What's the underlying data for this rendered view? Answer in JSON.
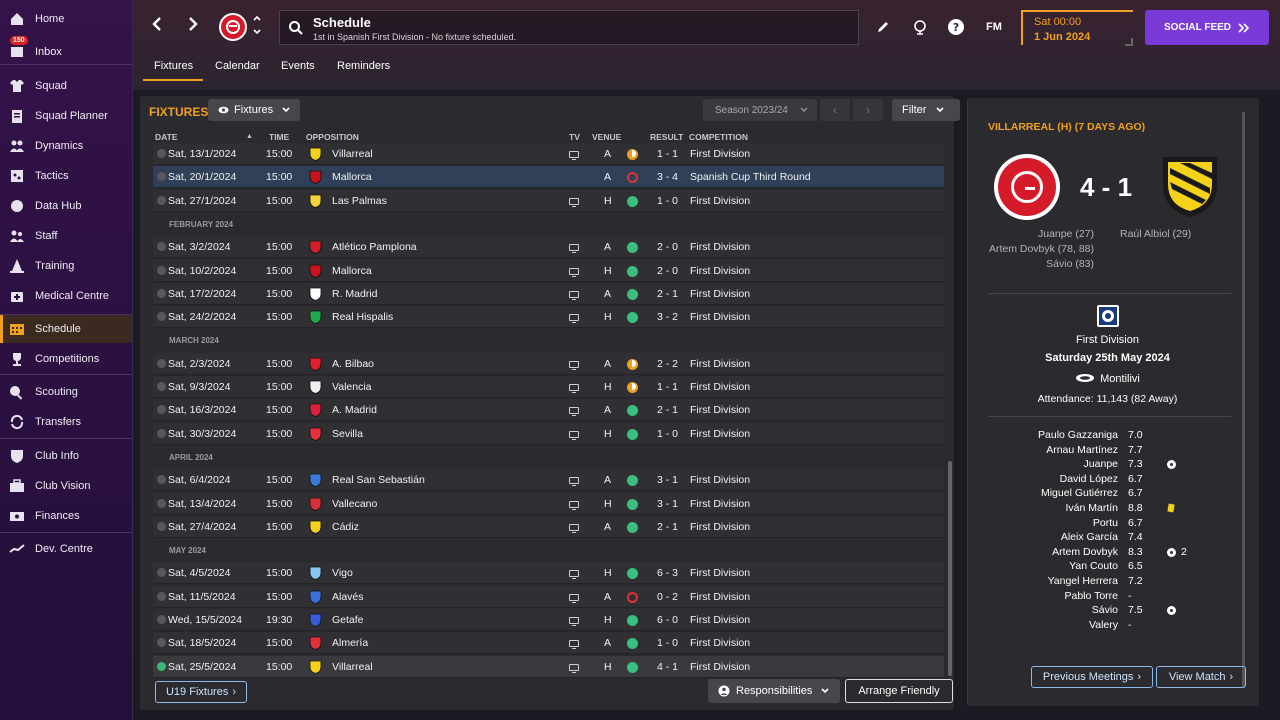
{
  "sidebar": {
    "items": [
      {
        "label": "Home",
        "icon": "home-icon"
      },
      {
        "label": "Inbox",
        "icon": "inbox-icon",
        "badge": "150"
      },
      {
        "label": "Squad",
        "icon": "shirt-icon"
      },
      {
        "label": "Squad Planner",
        "icon": "clipboard-icon"
      },
      {
        "label": "Dynamics",
        "icon": "people-icon"
      },
      {
        "label": "Tactics",
        "icon": "tactics-board-icon"
      },
      {
        "label": "Data Hub",
        "icon": "data-hub-icon"
      },
      {
        "label": "Staff",
        "icon": "staff-icon"
      },
      {
        "label": "Training",
        "icon": "cone-icon"
      },
      {
        "label": "Medical Centre",
        "icon": "medical-icon"
      },
      {
        "label": "Schedule",
        "icon": "calendar-icon"
      },
      {
        "label": "Competitions",
        "icon": "trophy-icon"
      },
      {
        "label": "Scouting",
        "icon": "binoculars-icon"
      },
      {
        "label": "Transfers",
        "icon": "transfer-icon"
      },
      {
        "label": "Club Info",
        "icon": "shield-icon"
      },
      {
        "label": "Club Vision",
        "icon": "briefcase-icon"
      },
      {
        "label": "Finances",
        "icon": "money-icon"
      },
      {
        "label": "Dev. Centre",
        "icon": "dev-centre-icon"
      }
    ]
  },
  "header": {
    "title": "Schedule",
    "subtitle": "1st in Spanish First Division - No fixture scheduled.",
    "fm_label": "FM",
    "date_time": "Sat 00:00",
    "date_day": "1 Jun 2024",
    "social_label": "SOCIAL FEED",
    "tabs": [
      "Fixtures",
      "Calendar",
      "Events",
      "Reminders"
    ]
  },
  "fixtures": {
    "label": "FIXTURES",
    "view_dropdown": "Fixtures",
    "season": "Season 2023/24",
    "filter_label": "Filter",
    "columns": {
      "date": "DATE",
      "time": "TIME",
      "opposition": "OPPOSITION",
      "tv": "TV",
      "venue": "VENUE",
      "result": "RESULT",
      "competition": "COMPETITION"
    },
    "rows": [
      {
        "type": "match",
        "date": "Sat, 13/1/2024",
        "time": "15:00",
        "team": "Villarreal",
        "crest": "#f3d219",
        "tv": true,
        "venue": "A",
        "outcome": "D",
        "score": "1 - 1",
        "competition": "First Division"
      },
      {
        "type": "match",
        "date": "Sat, 20/1/2024",
        "time": "15:00",
        "team": "Mallorca",
        "crest": "#c8121e",
        "tv": false,
        "venue": "A",
        "outcome": "L",
        "score": "3 - 4",
        "competition": "Spanish Cup Third Round",
        "selected": true
      },
      {
        "type": "match",
        "date": "Sat, 27/1/2024",
        "time": "15:00",
        "team": "Las Palmas",
        "crest": "#f6d33a",
        "tv": true,
        "venue": "H",
        "outcome": "W",
        "score": "1 - 0",
        "competition": "First Division"
      },
      {
        "type": "month",
        "label": "FEBRUARY 2024"
      },
      {
        "type": "match",
        "date": "Sat, 3/2/2024",
        "time": "15:00",
        "team": "Atlético Pamplona",
        "crest": "#d5202c",
        "tv": true,
        "venue": "A",
        "outcome": "W",
        "score": "2 - 0",
        "competition": "First Division"
      },
      {
        "type": "match",
        "date": "Sat, 10/2/2024",
        "time": "15:00",
        "team": "Mallorca",
        "crest": "#c8121e",
        "tv": true,
        "venue": "H",
        "outcome": "W",
        "score": "2 - 0",
        "competition": "First Division"
      },
      {
        "type": "match",
        "date": "Sat, 17/2/2024",
        "time": "15:00",
        "team": "R. Madrid",
        "crest": "#ffffff",
        "tv": true,
        "venue": "A",
        "outcome": "W",
        "score": "2 - 1",
        "competition": "First Division"
      },
      {
        "type": "match",
        "date": "Sat, 24/2/2024",
        "time": "15:00",
        "team": "Real Hispalis",
        "crest": "#1fa84c",
        "tv": true,
        "venue": "H",
        "outcome": "W",
        "score": "3 - 2",
        "competition": "First Division"
      },
      {
        "type": "month",
        "label": "MARCH 2024"
      },
      {
        "type": "match",
        "date": "Sat, 2/3/2024",
        "time": "15:00",
        "team": "A. Bilbao",
        "crest": "#e02030",
        "tv": true,
        "venue": "A",
        "outcome": "D",
        "score": "2 - 2",
        "competition": "First Division"
      },
      {
        "type": "match",
        "date": "Sat, 9/3/2024",
        "time": "15:00",
        "team": "Valencia",
        "crest": "#f0f0f0",
        "tv": true,
        "venue": "H",
        "outcome": "D",
        "score": "1 - 1",
        "competition": "First Division"
      },
      {
        "type": "match",
        "date": "Sat, 16/3/2024",
        "time": "15:00",
        "team": "A. Madrid",
        "crest": "#d8243a",
        "tv": true,
        "venue": "A",
        "outcome": "W",
        "score": "2 - 1",
        "competition": "First Division"
      },
      {
        "type": "match",
        "date": "Sat, 30/3/2024",
        "time": "15:00",
        "team": "Sevilla",
        "crest": "#e8303a",
        "tv": true,
        "venue": "H",
        "outcome": "W",
        "score": "1 - 0",
        "competition": "First Division"
      },
      {
        "type": "month",
        "label": "APRIL 2024"
      },
      {
        "type": "match",
        "date": "Sat, 6/4/2024",
        "time": "15:00",
        "team": "Real San Sebastián",
        "crest": "#3a7ad8",
        "tv": true,
        "venue": "A",
        "outcome": "W",
        "score": "3 - 1",
        "competition": "First Division"
      },
      {
        "type": "match",
        "date": "Sat, 13/4/2024",
        "time": "15:00",
        "team": "Vallecano",
        "crest": "#d8303a",
        "tv": true,
        "venue": "H",
        "outcome": "W",
        "score": "3 - 1",
        "competition": "First Division"
      },
      {
        "type": "match",
        "date": "Sat, 27/4/2024",
        "time": "15:00",
        "team": "Cádiz",
        "crest": "#f3d219",
        "tv": true,
        "venue": "A",
        "outcome": "W",
        "score": "2 - 1",
        "competition": "First Division"
      },
      {
        "type": "month",
        "label": "MAY 2024"
      },
      {
        "type": "match",
        "date": "Sat, 4/5/2024",
        "time": "15:00",
        "team": "Vigo",
        "crest": "#8ac4f0",
        "tv": true,
        "venue": "H",
        "outcome": "W",
        "score": "6 - 3",
        "competition": "First Division"
      },
      {
        "type": "match",
        "date": "Sat, 11/5/2024",
        "time": "15:00",
        "team": "Alavés",
        "crest": "#3a6ed8",
        "tv": true,
        "venue": "A",
        "outcome": "L",
        "score": "0 - 2",
        "competition": "First Division"
      },
      {
        "type": "match",
        "date": "Wed, 15/5/2024",
        "time": "19:30",
        "team": "Getafe",
        "crest": "#3a5ad8",
        "tv": true,
        "venue": "H",
        "outcome": "W",
        "score": "6 - 0",
        "competition": "First Division"
      },
      {
        "type": "match",
        "date": "Sat, 18/5/2024",
        "time": "15:00",
        "team": "Almería",
        "crest": "#e0303a",
        "tv": true,
        "venue": "A",
        "outcome": "W",
        "score": "1 - 0",
        "competition": "First Division"
      },
      {
        "type": "match",
        "date": "Sat, 25/5/2024",
        "time": "15:00",
        "team": "Villarreal",
        "crest": "#f3d219",
        "tv": true,
        "venue": "H",
        "outcome": "W",
        "score": "4 - 1",
        "competition": "First Division",
        "last": true
      }
    ],
    "u19_label": "U19 Fixtures",
    "responsibilities_label": "Responsibilities",
    "arrange_friendly_label": "Arrange Friendly"
  },
  "match_panel": {
    "heading": "VILLARREAL (H) (7 DAYS AGO)",
    "score": "4 - 1",
    "home_scorers": [
      "Juanpe (27)",
      "Artem Dovbyk (78, 88)",
      "Sávio (83)"
    ],
    "away_scorers": [
      "Raúl Albiol (29)"
    ],
    "competition": "First Division",
    "date": "Saturday 25th May 2024",
    "stadium": "Montilivi",
    "attendance": "Attendance: 11,143 (82 Away)",
    "players": [
      {
        "name": "Paulo Gazzaniga",
        "rating": "7.0"
      },
      {
        "name": "Arnau Martínez",
        "rating": "7.7"
      },
      {
        "name": "Juanpe",
        "rating": "7.3",
        "goal": true
      },
      {
        "name": "David López",
        "rating": "6.7"
      },
      {
        "name": "Miguel Gutiérrez",
        "rating": "6.7"
      },
      {
        "name": "Iván Martín",
        "rating": "8.8",
        "card": true
      },
      {
        "name": "Portu",
        "rating": "6.7"
      },
      {
        "name": "Aleix García",
        "rating": "7.4"
      },
      {
        "name": "Artem Dovbyk",
        "rating": "8.3",
        "goal": true,
        "goals": "2"
      },
      {
        "name": "Yan Couto",
        "rating": "6.5"
      },
      {
        "name": "Yangel Herrera",
        "rating": "7.2"
      },
      {
        "name": "Pablo Torre",
        "rating": "-"
      },
      {
        "name": "Sávio",
        "rating": "7.5",
        "goal": true
      },
      {
        "name": "Valery",
        "rating": "-"
      }
    ],
    "prev_meetings_label": "Previous Meetings",
    "view_match_label": "View Match"
  },
  "colors": {
    "accent": "#f0a020",
    "win": "#3ac07e",
    "loss": "#dd3333",
    "social": "#7a3ad8"
  }
}
